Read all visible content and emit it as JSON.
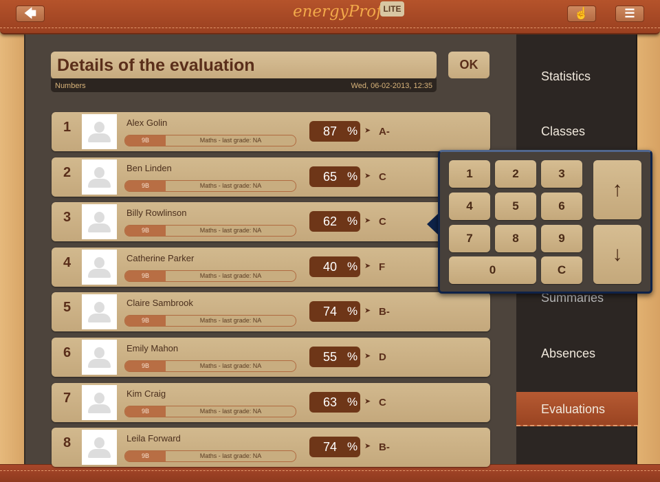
{
  "topbar": {
    "back_icon": "arrow-left-icon",
    "logo": "energyProf",
    "lite_badge": "LITE",
    "touch_icon": "hand-pointer-icon",
    "menu_icon": "hamburger-menu-icon"
  },
  "header": {
    "title": "Details of the evaluation",
    "ok_label": "OK",
    "type": "Numbers",
    "date": "Wed, 06-02-2013, 12:35"
  },
  "students": [
    {
      "num": "1",
      "name": "Alex Golin",
      "class": "9B",
      "subject": "Maths - last grade: NA",
      "score": "87",
      "pct": "%",
      "arrow": "➤",
      "grade": "A-"
    },
    {
      "num": "2",
      "name": "Ben Linden",
      "class": "9B",
      "subject": "Maths - last grade: NA",
      "score": "65",
      "pct": "%",
      "arrow": "➤",
      "grade": "C"
    },
    {
      "num": "3",
      "name": "Billy Rowlinson",
      "class": "9B",
      "subject": "Maths - last grade: NA",
      "score": "62",
      "pct": "%",
      "arrow": "➤",
      "grade": "C"
    },
    {
      "num": "4",
      "name": "Catherine Parker",
      "class": "9B",
      "subject": "Maths - last grade: NA",
      "score": "40",
      "pct": "%",
      "arrow": "➤",
      "grade": "F"
    },
    {
      "num": "5",
      "name": "Claire Sambrook",
      "class": "9B",
      "subject": "Maths - last grade: NA",
      "score": "74",
      "pct": "%",
      "arrow": "➤",
      "grade": "B-"
    },
    {
      "num": "6",
      "name": "Emily Mahon",
      "class": "9B",
      "subject": "Maths - last grade: NA",
      "score": "55",
      "pct": "%",
      "arrow": "➤",
      "grade": "D"
    },
    {
      "num": "7",
      "name": "Kim Craig",
      "class": "9B",
      "subject": "Maths - last grade: NA",
      "score": "63",
      "pct": "%",
      "arrow": "➤",
      "grade": "C"
    },
    {
      "num": "8",
      "name": "Leila Forward",
      "class": "9B",
      "subject": "Maths - last grade: NA",
      "score": "74",
      "pct": "%",
      "arrow": "➤",
      "grade": "B-"
    }
  ],
  "sidebar": {
    "items": [
      {
        "label": "Statistics"
      },
      {
        "label": "Classes"
      },
      {
        "label": "Summaries"
      },
      {
        "label": "Absences"
      },
      {
        "label": "Evaluations",
        "selected": true
      }
    ]
  },
  "keypad": {
    "keys": [
      "1",
      "2",
      "3",
      "4",
      "5",
      "6",
      "7",
      "8",
      "9",
      "0",
      "C"
    ],
    "up": "↑",
    "down": "↓"
  }
}
